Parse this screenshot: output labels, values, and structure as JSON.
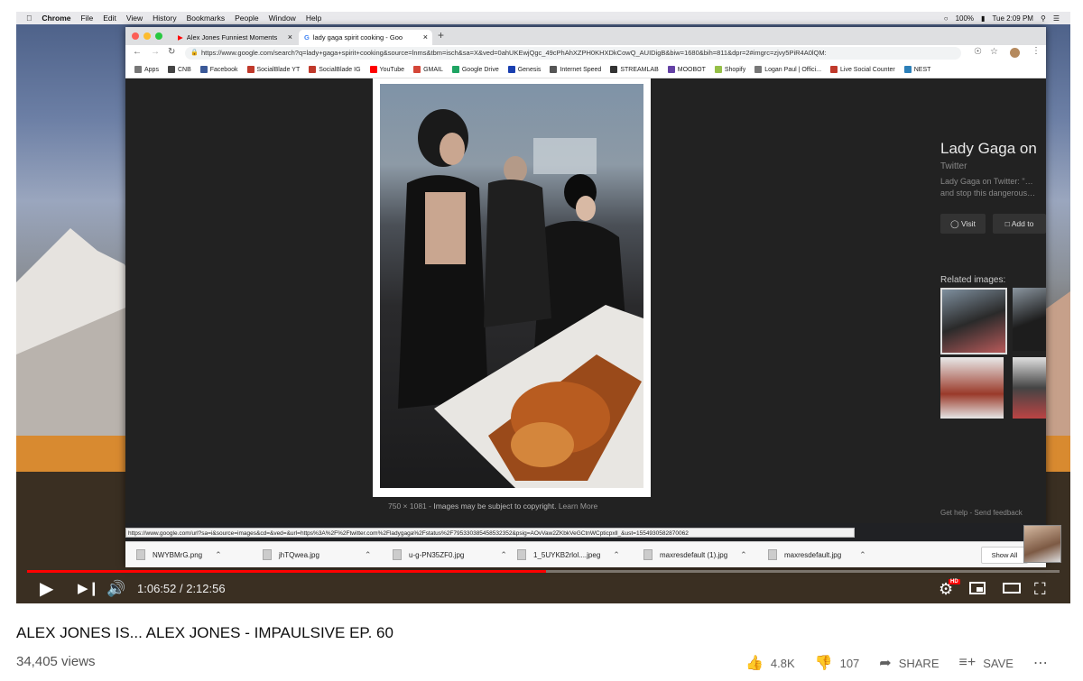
{
  "menubar": {
    "items": [
      "Chrome",
      "File",
      "Edit",
      "View",
      "History",
      "Bookmarks",
      "People",
      "Window",
      "Help"
    ],
    "battery": "100%",
    "clock": "Tue 2:09 PM"
  },
  "browser": {
    "tabs": [
      {
        "label": "Alex Jones Funniest Moments"
      },
      {
        "label": "lady gaga spirit cooking - Goo"
      }
    ],
    "new_tab": "+",
    "url": "https://www.google.com/search?q=lady+gaga+spirit+cooking&source=lnms&tbm=isch&sa=X&ved=0ahUKEwjQgc_49cPhAhXZPH0KHXDkCowQ_AUIDigB&biw=1680&bih=811&dpr=2#imgrc=zjvy5PiR4A0lQM:",
    "bookmarks": [
      "Apps",
      "CNB",
      "Facebook",
      "SocialBlade YT",
      "SocialBlade IG",
      "YouTube",
      "GMAIL",
      "Google Drive",
      "Genesis",
      "Internet Speed",
      "STREAMLAB",
      "MOOBOT",
      "Shopify",
      "Logan Paul | Offici...",
      "Live Social Counter",
      "NEST"
    ],
    "bookmark_colors": [
      "#777777",
      "#444444",
      "#3b5998",
      "#c0392b",
      "#c0392b",
      "#ff0000",
      "#d44638",
      "#1fa463",
      "#1a3fb0",
      "#555555",
      "#333333",
      "#6441a5",
      "#95bf47",
      "#777777",
      "#c0392b",
      "#2c7fb8"
    ]
  },
  "image_viewer": {
    "caption_size": "750 × 1081",
    "caption_text": "Images may be subject to copyright.",
    "learn_more": "Learn More",
    "panel_title": "Lady Gaga on",
    "panel_source": "Twitter",
    "panel_desc": "Lady Gaga on Twitter: \"… and stop this dangerous…",
    "visit_label": "Visit",
    "addto_label": "Add to",
    "related_label": "Related images:",
    "get_help": "Get help",
    "send_feedback": "Send feedback"
  },
  "status_url": "https://www.google.com/url?sa=i&source=images&cd=&ved=&url=https%3A%2F%2Ftwitter.com%2Fladygaga%2Fstatus%2F795330385458532352&psig=AOvVaw2ZKbkVeGCtnWCpticpxll_&ust=1554930582870062",
  "downloads": {
    "files": [
      "NWYBMrG.png",
      "jhTQwea.jpg",
      "u-g-PN35ZF0.jpg",
      "1_5UYKB2rlol....jpeg",
      "maxresdefault (1).jpg",
      "maxresdefault.jpg"
    ],
    "show_all": "Show All"
  },
  "player": {
    "current_time": "1:06:52",
    "duration": "2:12:56",
    "time_display": "1:06:52 / 2:12:56",
    "progress_fraction": 0.503,
    "hd_badge": "HD"
  },
  "video": {
    "title": "ALEX JONES IS... ALEX JONES - IMPAULSIVE EP. 60",
    "views": "34,405 views",
    "likes": "4.8K",
    "dislikes": "107",
    "share_label": "SHARE",
    "save_label": "SAVE"
  },
  "icons": {
    "play": "play-icon",
    "next": "next-icon",
    "volume": "volume-icon",
    "settings": "settings-icon",
    "miniplayer": "miniplayer-icon",
    "theater": "theater-icon",
    "fullscreen": "fullscreen-icon",
    "like": "thumbs-up-icon",
    "dislike": "thumbs-down-icon",
    "share": "share-icon",
    "save": "playlist-add-icon",
    "more": "more-icon"
  },
  "colors": {
    "progress": "#ff0000",
    "viewer_bg": "#222222"
  }
}
